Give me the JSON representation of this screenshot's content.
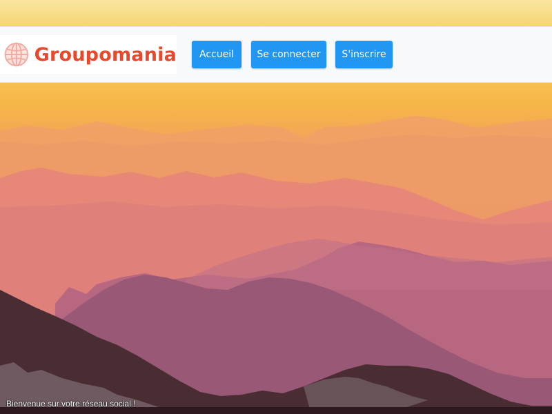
{
  "brand": {
    "name": "Groupomania",
    "icon": "globe-icon",
    "color": "#e8492c"
  },
  "nav": {
    "home_label": "Accueil",
    "login_label": "Se connecter",
    "signup_label": "S'inscrire",
    "button_color": "#2196f3"
  },
  "hero": {
    "image": "mountain-sunset-image",
    "welcome_text": "Bienvenue sur votre réseau social !"
  }
}
